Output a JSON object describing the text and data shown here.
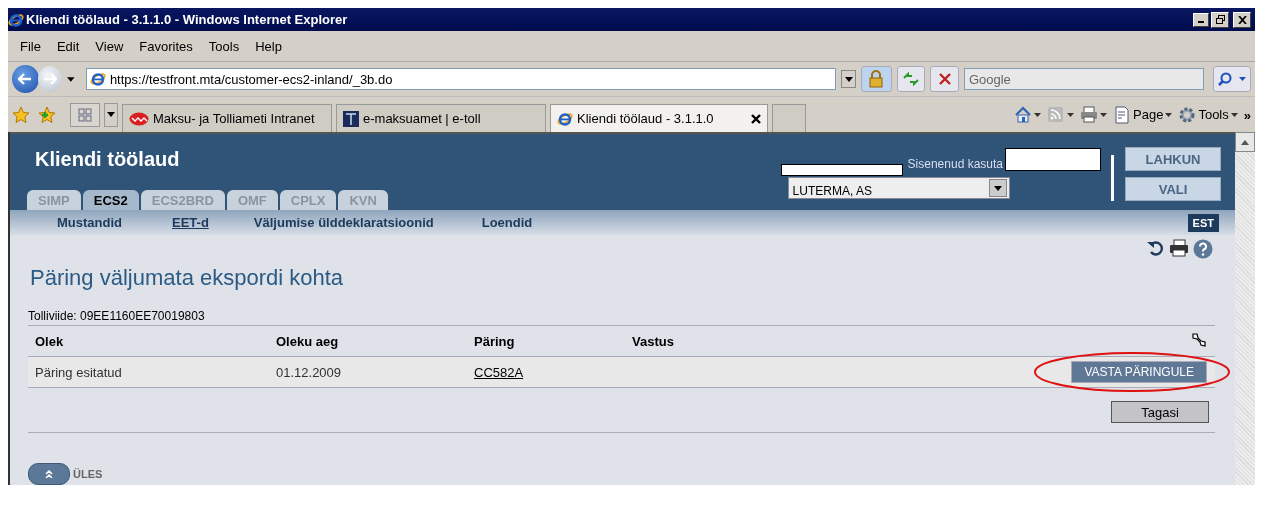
{
  "window": {
    "title": "Kliendi töölaud - 3.1.1.0 - Windows Internet Explorer"
  },
  "menu": [
    "File",
    "Edit",
    "View",
    "Favorites",
    "Tools",
    "Help"
  ],
  "address_bar": {
    "url": "https://testfront.mta/customer-ecs2-inland/_3b.do"
  },
  "search": {
    "placeholder": "Google"
  },
  "browser_tabs": [
    {
      "label": "Maksu- ja Tolliameti Intranet",
      "selected": false,
      "kind": "intranet"
    },
    {
      "label": "e-maksuamet | e-toll",
      "selected": false,
      "kind": "etoll"
    },
    {
      "label": "Kliendi töölaud - 3.1.1.0",
      "selected": true,
      "kind": "ie"
    }
  ],
  "command_bar": [
    {
      "kind": "home"
    },
    {
      "kind": "feeds"
    },
    {
      "kind": "print"
    },
    {
      "kind": "page",
      "label": "Page"
    },
    {
      "kind": "tools",
      "label": "Tools"
    }
  ],
  "command_more": "»",
  "app": {
    "title": "Kliendi töölaud",
    "user_label": "Sisenenud kasuta",
    "company": "LUTERMA, AS",
    "buttons": [
      "LAHKUN",
      "VALI"
    ],
    "tabs": [
      {
        "label": "SIMP",
        "selected": false
      },
      {
        "label": "ECS2",
        "selected": true
      },
      {
        "label": "ECS2BRD",
        "selected": false
      },
      {
        "label": "OMF",
        "selected": false
      },
      {
        "label": "CPLX",
        "selected": false
      },
      {
        "label": "KVN",
        "selected": false
      }
    ],
    "subnav": [
      {
        "label": "Mustandid",
        "selected": false
      },
      {
        "label": "EET-d",
        "selected": true
      },
      {
        "label": "Väljumise ülddeklaratsioonid",
        "selected": false
      },
      {
        "label": "Loendid",
        "selected": false
      }
    ],
    "language": "EST"
  },
  "page": {
    "heading": "Päring väljumata ekspordi kohta",
    "reference": "Tolliviide: 09EE1160EE70019803",
    "table": {
      "columns": [
        "Olek",
        "Oleku aeg",
        "Päring",
        "Vastus"
      ],
      "rows": [
        {
          "cells": [
            "Päring esitatud",
            "01.12.2009",
            "CC582A"
          ],
          "action": "VASTA PÄRINGULE",
          "highlighted": true
        }
      ]
    },
    "back_button": "Tagasi",
    "up_link": "ÜLES"
  }
}
